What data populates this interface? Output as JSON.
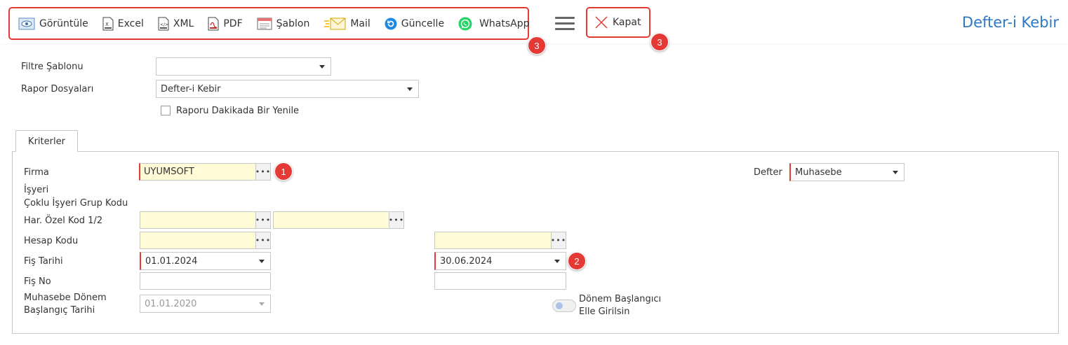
{
  "header": {
    "title": "Defter-i Kebir",
    "toolbar": {
      "view_label": "Görüntüle",
      "excel_label": "Excel",
      "xml_label": "XML",
      "pdf_label": "PDF",
      "template_label": "Şablon",
      "mail_label": "Mail",
      "refresh_label": "Güncelle",
      "whatsapp_label": "WhatsApp"
    },
    "close_label": "Kapat"
  },
  "badges": {
    "toolbar": "3",
    "close": "3",
    "firma": "1",
    "date_end": "2"
  },
  "top_form": {
    "filter_template_label": "Filtre Şablonu",
    "filter_template_value": "",
    "report_files_label": "Rapor Dosyaları",
    "report_files_value": "Defter-i Kebir",
    "auto_refresh_label": "Raporu Dakikada Bir Yenile"
  },
  "tabs": {
    "criteria": "Kriterler"
  },
  "criteria": {
    "firma_label": "Firma",
    "firma_value": "UYUMSOFT",
    "defter_label": "Defter",
    "defter_value": "Muhasebe",
    "isyeri_label": "İşyeri",
    "multi_isyeri_label": "Çoklu İşyeri Grup Kodu",
    "har_ozel_label": "Har. Özel Kod 1/2",
    "hesap_kodu_label": "Hesap Kodu",
    "fis_tarihi_label": "Fiş Tarihi",
    "fis_tarihi_start": "01.01.2024",
    "fis_tarihi_end": "30.06.2024",
    "fis_no_label": "Fiş No",
    "donem_label_1": "Muhasebe Dönem",
    "donem_label_2": "Başlangıç Tarihi",
    "donem_value": "01.01.2020",
    "manual_period_label_1": "Dönem Başlangıcı",
    "manual_period_label_2": "Elle Girilsin"
  },
  "colors": {
    "accent": "#2b78c5",
    "highlight_border": "#e53935",
    "required_field": "#fffbd6"
  }
}
